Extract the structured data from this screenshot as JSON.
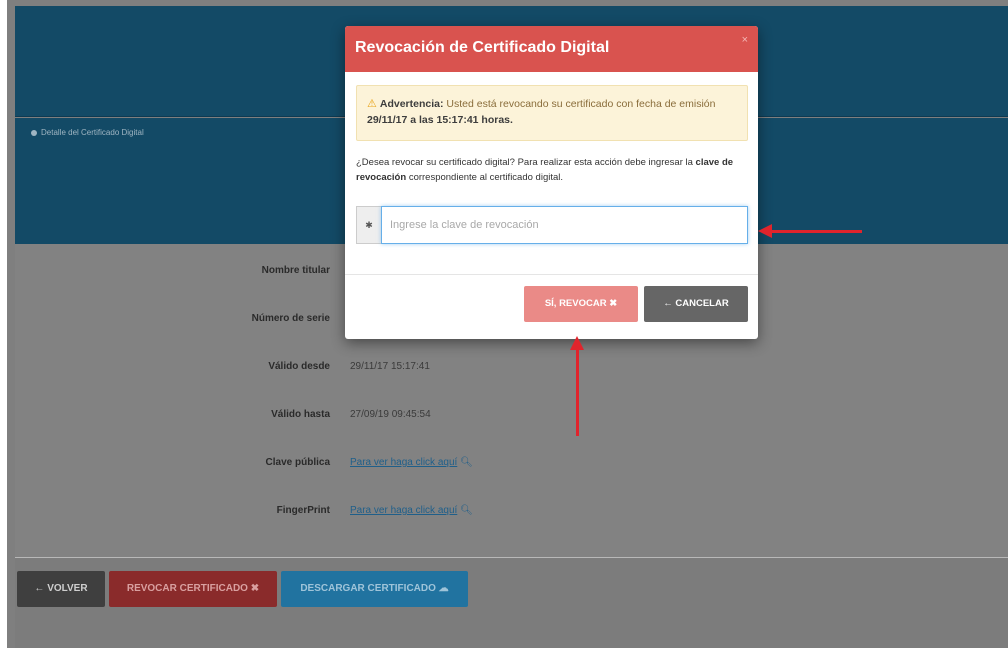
{
  "detail_panel": {
    "heading": "Detalle del Certificado Digital"
  },
  "info": {
    "rows": [
      {
        "label": "Nombre titular",
        "value": ""
      },
      {
        "label": "Número de serie",
        "value": ""
      },
      {
        "label": "Válido desde",
        "value": "29/11/17 15:17:41"
      },
      {
        "label": "Válido hasta",
        "value": "27/09/19 09:45:54"
      },
      {
        "label": "Clave pública",
        "value": "Para ver haga click aquí"
      },
      {
        "label": "FingerPrint",
        "value": "Para ver haga click aquí"
      }
    ]
  },
  "buttons": {
    "back": "VOLVER",
    "revoke": "REVOCAR CERTIFICADO",
    "download": "DESCARGAR CERTIFICADO"
  },
  "modal": {
    "title": "Revocación de Certificado Digital",
    "close": "×",
    "warning_label": "Advertencia:",
    "warning_text": "Usted está revocando su certificado con fecha de emisión",
    "warning_date": "29/11/17 a las 15:17:41 horas.",
    "question_pre": "¿Desea revocar su certificado digital? Para realizar esta acción debe ingresar la",
    "question_bold": "clave de revocación",
    "question_post": "correspondiente al certificado digital.",
    "input_placeholder": "Ingrese la clave de revocación",
    "input_value": "",
    "confirm": "SÍ, REVOCAR",
    "cancel": "CANCELAR"
  },
  "colors": {
    "header": "#d9534f",
    "panel": "#134a66",
    "annotation": "#e0242c"
  },
  "icons": {
    "warning": "warning-triangle-icon",
    "asterisk": "asterisk-icon",
    "back_arrow": "arrow-left-icon",
    "cancel_arrow": "arrow-left-icon",
    "confirm_x": "times-icon",
    "revoke_x": "times-icon",
    "download": "cloud-download-icon",
    "search": "search-icon"
  }
}
